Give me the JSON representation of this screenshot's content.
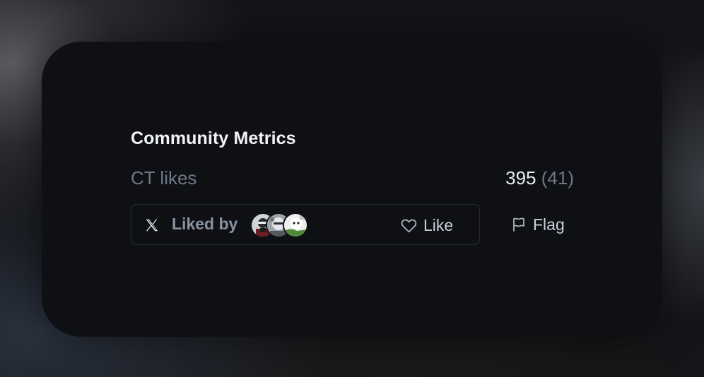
{
  "section": {
    "title": "Community Metrics"
  },
  "metrics": {
    "ct_likes_label": "CT likes",
    "ct_likes_value": "395",
    "ct_likes_sub": "(41)"
  },
  "liked_by": {
    "platform_icon": "x-logo-icon",
    "label": "Liked by",
    "avatar_count": 3
  },
  "actions": {
    "like_label": "Like",
    "like_icon": "heart-icon",
    "flag_label": "Flag",
    "flag_icon": "flag-icon"
  },
  "colors": {
    "card_bg": "#0e1014",
    "title": "#f1f3f6",
    "muted": "#6d7888",
    "border": "#262c36"
  }
}
